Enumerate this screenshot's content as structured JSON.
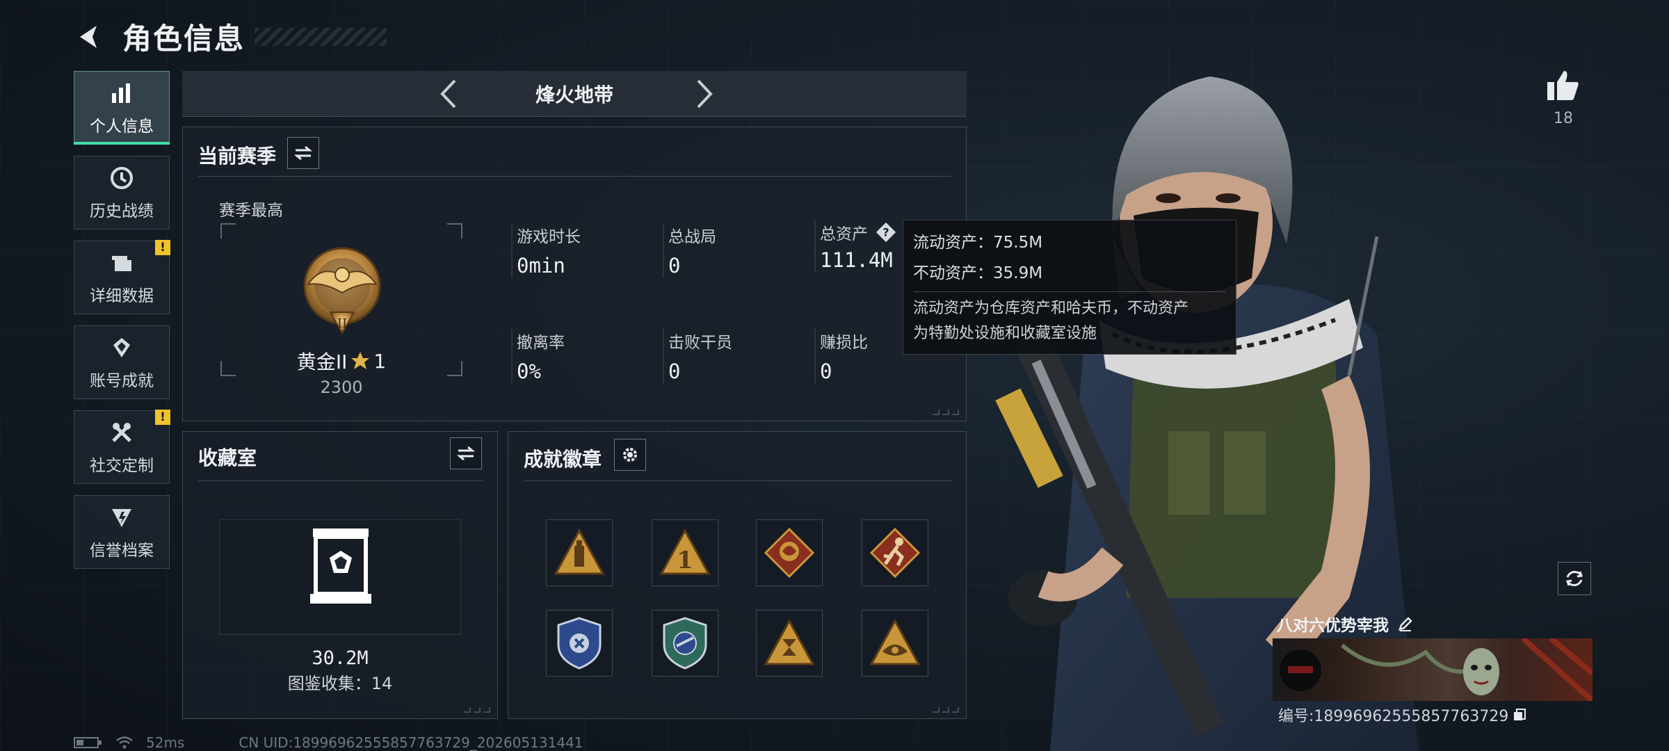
{
  "header": {
    "title": "角色信息"
  },
  "nav": {
    "items": [
      {
        "label": "个人信息",
        "active": true,
        "icon": "bar-chart-icon",
        "alert": false
      },
      {
        "label": "历史战绩",
        "active": false,
        "icon": "history-icon",
        "alert": false
      },
      {
        "label": "详细数据",
        "active": false,
        "icon": "folder-icon",
        "alert": true
      },
      {
        "label": "账号成就",
        "active": false,
        "icon": "achievement-icon",
        "alert": false
      },
      {
        "label": "社交定制",
        "active": false,
        "icon": "tools-icon",
        "alert": true
      },
      {
        "label": "信誉档案",
        "active": false,
        "icon": "credit-icon",
        "alert": false
      }
    ],
    "alert_mark": "!"
  },
  "mode": {
    "name": "烽火地带"
  },
  "season": {
    "title": "当前赛季",
    "best_label": "赛季最高",
    "rank_name": "黄金II",
    "rank_stars": "1",
    "rank_score": "2300",
    "stats": [
      {
        "label": "游戏时长",
        "value": "0min"
      },
      {
        "label": "总战局",
        "value": "0"
      },
      {
        "label": "总资产",
        "value": "111.4M",
        "has_help": true
      },
      {
        "label": "撤离率",
        "value": "0%"
      },
      {
        "label": "击败干员",
        "value": "0"
      },
      {
        "label": "赚损比",
        "value": "0"
      }
    ]
  },
  "tooltip": {
    "liquid": "流动资产：75.5M",
    "fixed": "不动资产：35.9M",
    "desc_line1": "流动资产为仓库资产和哈夫币，不动资产",
    "desc_line2": "为特勤处设施和收藏室设施"
  },
  "collection": {
    "title": "收藏室",
    "value": "30.2M",
    "count": "图鉴收集：14"
  },
  "badges": {
    "title": "成就徽章",
    "items": [
      {
        "icon": "bottle-badge-icon",
        "color": "#c9963a"
      },
      {
        "icon": "number-one-badge-icon",
        "color": "#c9963a"
      },
      {
        "icon": "dragon-badge-icon",
        "color": "#b2452e"
      },
      {
        "icon": "runner-badge-icon",
        "color": "#b2452e"
      },
      {
        "icon": "shield-blue-badge-icon",
        "color": "#3a5fa8"
      },
      {
        "icon": "shield-green-badge-icon",
        "color": "#3d8a6a"
      },
      {
        "icon": "hourglass-badge-icon",
        "color": "#c9963a"
      },
      {
        "icon": "eye-badge-icon",
        "color": "#c9963a"
      }
    ]
  },
  "profile": {
    "likes": "18",
    "card_name": "八对六优势宰我",
    "card_id": "编号:18996962555857763729"
  },
  "status": {
    "ping": "52ms",
    "uid": "CN UID:18996962555857763729_202605131441"
  },
  "colors": {
    "accent": "#3fe0a8",
    "alert": "#f0c52a",
    "gold": "#c9963a"
  }
}
